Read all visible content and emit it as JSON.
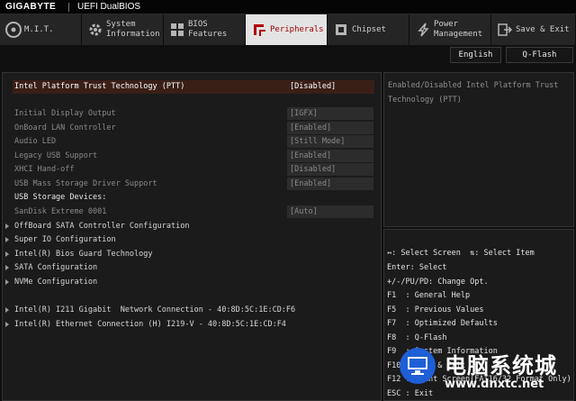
{
  "header": {
    "brand": "GIGABYTE",
    "product": "UEFI DualBIOS"
  },
  "tabs": [
    {
      "label": "M.I.T.",
      "icon": "disc-icon",
      "active": false
    },
    {
      "label": "System\nInformation",
      "icon": "gear-icon",
      "active": false
    },
    {
      "label": "BIOS\nFeatures",
      "icon": "grid-icon",
      "active": false
    },
    {
      "label": "Peripherals",
      "icon": "peripherals-icon",
      "active": true
    },
    {
      "label": "Chipset",
      "icon": "chip-icon",
      "active": false
    },
    {
      "label": "Power\nManagement",
      "icon": "power-icon",
      "active": false
    },
    {
      "label": "Save & Exit",
      "icon": "exit-icon",
      "active": false
    }
  ],
  "buttons": {
    "language": "English",
    "qflash": "Q-Flash"
  },
  "settings": [
    {
      "label": "Intel Platform Trust Technology (PTT)",
      "value": "[Disabled]",
      "state": "highlight"
    },
    {
      "label": "Initial Display Output",
      "value": "[IGFX]",
      "state": "dim"
    },
    {
      "label": "OnBoard LAN Controller",
      "value": "[Enabled]",
      "state": "dim"
    },
    {
      "label": "Audio LED",
      "value": "[Still Mode]",
      "state": "dim"
    },
    {
      "label": "Legacy USB Support",
      "value": "[Enabled]",
      "state": "dim"
    },
    {
      "label": "XHCI Hand-off",
      "value": "[Disabled]",
      "state": "dim"
    },
    {
      "label": "USB Mass Storage Driver Support",
      "value": "[Enabled]",
      "state": "dim"
    },
    {
      "label": "USB Storage Devices:",
      "value": "",
      "state": "sub"
    },
    {
      "label": "SanDisk Extreme 0001",
      "value": "[Auto]",
      "state": "dim"
    }
  ],
  "submenus": [
    "OffBoard SATA Controller Configuration",
    "Super IO Configuration",
    "Intel(R) Bios Guard Technology",
    "SATA Configuration",
    "NVMe Configuration"
  ],
  "network": [
    "Intel(R) I211 Gigabit  Network Connection - 40:8D:5C:1E:CD:F6",
    "Intel(R) Ethernet Connection (H) I219-V - 40:8D:5C:1E:CD:F4"
  ],
  "help": {
    "text": "Enabled/Disabled Intel Platform Trust Technology (PTT)"
  },
  "keys": [
    "↔: Select Screen  ⇅: Select Item",
    "Enter: Select",
    "+/-/PU/PD: Change Opt.",
    "F1  : General Help",
    "F5  : Previous Values",
    "F7  : Optimized Defaults",
    "F8  : Q-Flash",
    "F9  : System Information",
    "F10 : Save & Exit",
    "F12 : Print Screen(FAT16/32 Format Only)",
    "ESC : Exit"
  ],
  "watermark": {
    "text": "电脑系统城",
    "url": "www.dnxtc.net"
  },
  "colors": {
    "active_tab_bg": "#e3e3e3",
    "active_tab_text": "#9c0000",
    "highlight_row": "#3a1f16",
    "panel_bg": "#1b1b1b",
    "watermark_blue": "#1f5fd6"
  }
}
